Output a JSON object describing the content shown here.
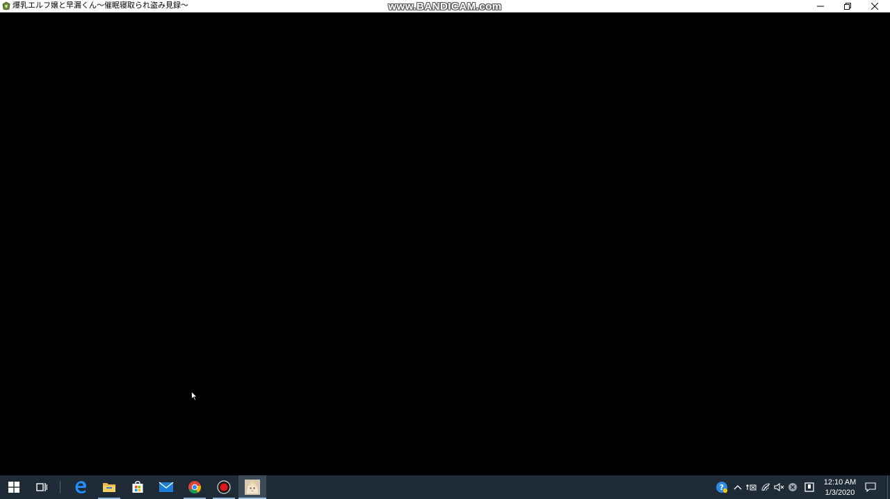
{
  "window": {
    "title": "爆乳エルフ嬢と早漏くん～催眠寝取られ盗み見録～",
    "watermark": "www.BANDICAM.com"
  },
  "taskbar": {
    "apps": [
      {
        "name": "start",
        "icon": "windows-logo-icon"
      },
      {
        "name": "task-view",
        "icon": "task-view-icon"
      },
      {
        "name": "edge",
        "icon": "edge-icon"
      },
      {
        "name": "file-explorer",
        "icon": "folder-icon"
      },
      {
        "name": "microsoft-store",
        "icon": "store-bag-icon"
      },
      {
        "name": "mail",
        "icon": "mail-icon"
      },
      {
        "name": "chrome",
        "icon": "chrome-icon"
      },
      {
        "name": "bandicam",
        "icon": "record-icon"
      },
      {
        "name": "game",
        "icon": "game-app-icon"
      }
    ],
    "tray": {
      "icons": [
        "help-icon",
        "chevron-up-icon",
        "ime-icon",
        "wifi-icon",
        "volume-muted-icon",
        "close-circle-icon",
        "bandicam-tray-icon"
      ],
      "time": "12:10 AM",
      "date": "1/3/2020"
    }
  },
  "colors": {
    "taskbar_bg": "#1f2b36",
    "titlebar_bg": "#ffffff",
    "viewport_bg": "#000000"
  }
}
